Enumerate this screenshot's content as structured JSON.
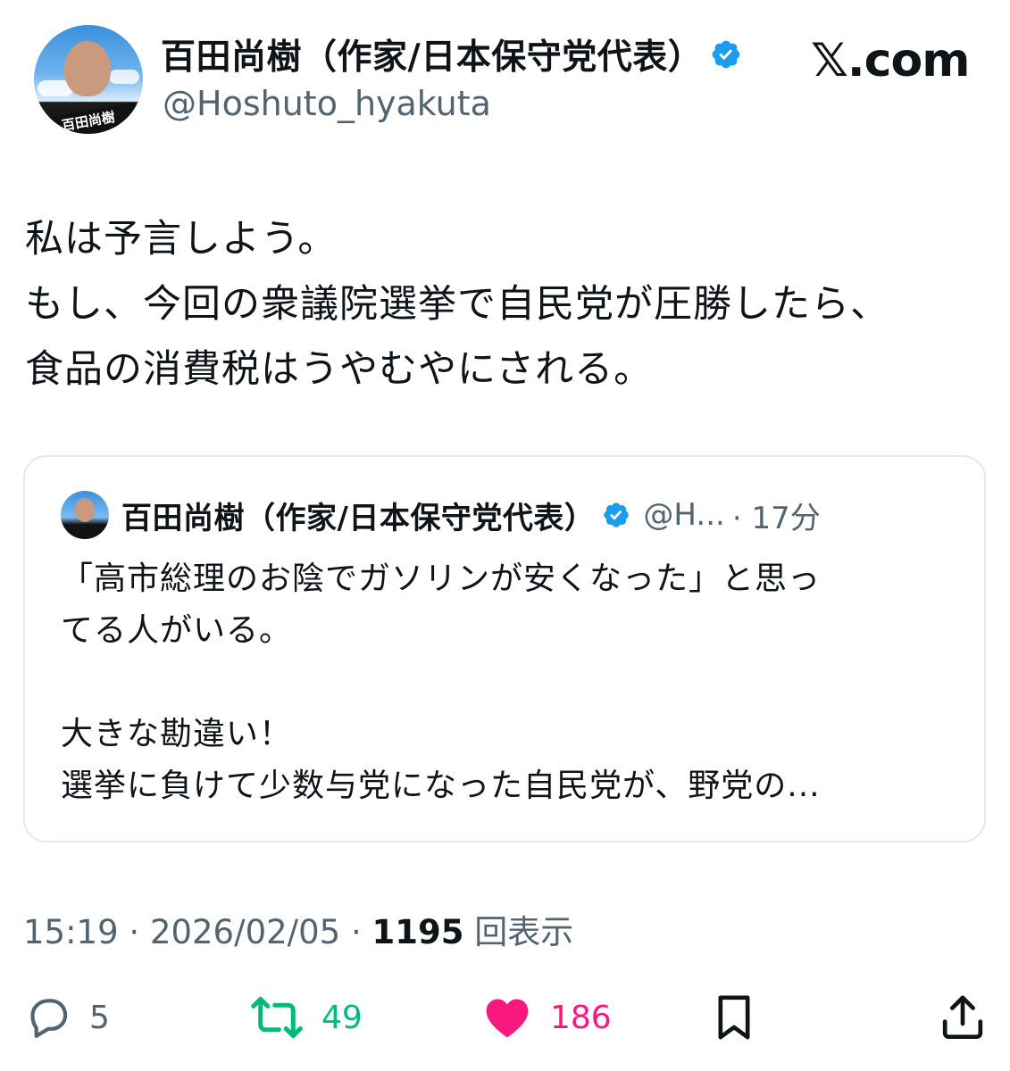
{
  "header": {
    "author_name": "百田尚樹（作家/日本保守党代表）",
    "handle": "@Hoshuto_hyakuta",
    "avatar_sign": "百田尚樹",
    "site_label": "𝕏.com"
  },
  "tweet": {
    "lines": [
      "私は予言しよう。",
      "もし、今回の衆議院選挙で自民党が圧勝したら、",
      "食品の消費税はうやむやにされる。"
    ]
  },
  "quote": {
    "author_name": "百田尚樹（作家/日本保守党代表）",
    "handle_truncated": "@H...",
    "time": "· 17分",
    "lines": [
      "「高市総理のお陰でガソリンが安くなった」と思っ",
      "てる人がいる。",
      "",
      "大きな勘違い！",
      "選挙に負けて少数与党になった自民党が、野党の..."
    ]
  },
  "meta": {
    "time": "15:19",
    "date": "2026/02/05",
    "separator": " · ",
    "views_count": "1195",
    "views_label": "回表示"
  },
  "actions": {
    "replies": "5",
    "retweets": "49",
    "likes": "186"
  },
  "colors": {
    "verified": "#1d9bf0",
    "retweet": "#00ba7c",
    "like": "#f91880",
    "secondary_text": "#536471"
  },
  "icons": [
    "verified-badge-icon",
    "reply-icon",
    "retweet-icon",
    "heart-icon",
    "bookmark-icon",
    "share-icon"
  ]
}
